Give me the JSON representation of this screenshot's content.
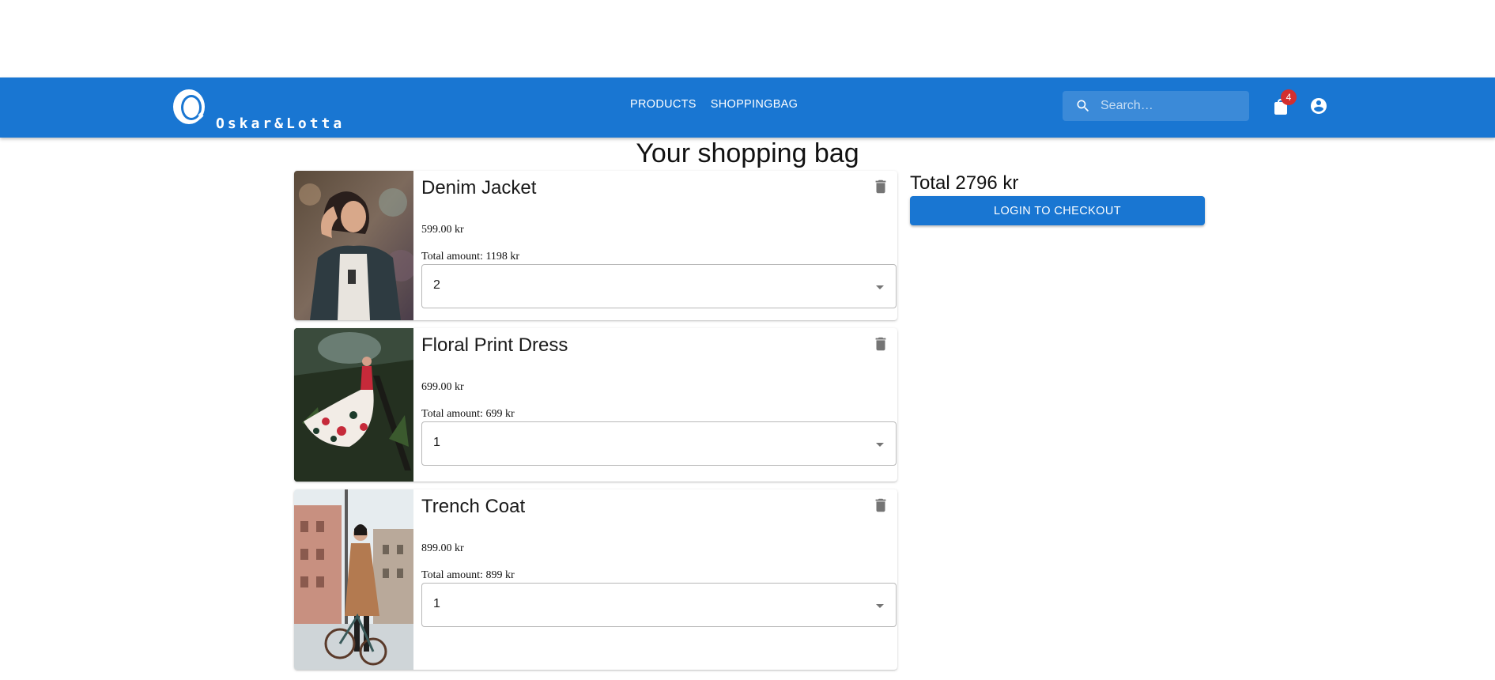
{
  "header": {
    "logo_text": "Oskar&Lotta",
    "nav": [
      {
        "label": "PRODUCTS"
      },
      {
        "label": "SHOPPINGBAG"
      }
    ],
    "search_placeholder": "Search…",
    "bag_count": "4",
    "icons": {
      "logo": "oskar-lotta-logo",
      "search": "search-icon",
      "bag": "shopping-bag-icon",
      "account": "account-circle-icon"
    }
  },
  "page": {
    "title": "Your shopping bag"
  },
  "items": [
    {
      "name": "Denim Jacket",
      "price": "599.00 kr",
      "total": "Total amount: 1198 kr",
      "quantity": "2",
      "image_desc": "woman-in-denim-jacket"
    },
    {
      "name": "Floral Print Dress",
      "price": "699.00 kr",
      "total": "Total amount: 699 kr",
      "quantity": "1",
      "image_desc": "woman-in-floral-dress"
    },
    {
      "name": "Trench Coat",
      "price": "899.00 kr",
      "total": "Total amount: 899 kr",
      "quantity": "1",
      "image_desc": "woman-in-trench-coat-with-bicycle"
    }
  ],
  "summary": {
    "total": "Total 2796 kr",
    "checkout_label": "LOGIN TO CHECKOUT"
  },
  "colors": {
    "primary": "#1976d2",
    "badge": "#d32f2f",
    "icon_grey": "#757575"
  }
}
